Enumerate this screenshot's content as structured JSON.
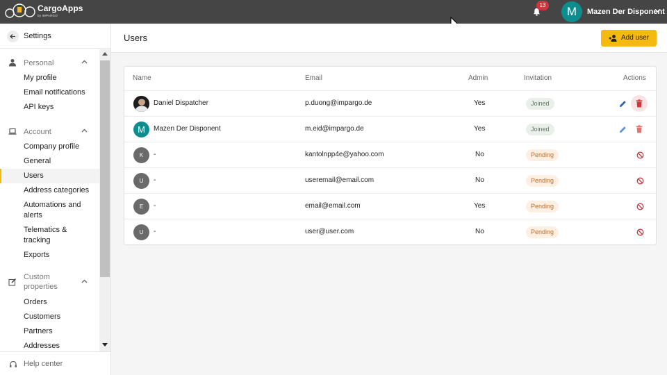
{
  "app": {
    "brand": "CargoApps",
    "brand_sub": "by IMPARGO",
    "notifications_count": "13",
    "user_initial": "M",
    "user_name": "Mazen Der Disponent"
  },
  "sidebar": {
    "title": "Settings",
    "sections": [
      {
        "label": "Personal",
        "items": [
          "My profile",
          "Email notifications",
          "API keys"
        ]
      },
      {
        "label": "Account",
        "items": [
          "Company profile",
          "General",
          "Users",
          "Address categories",
          "Automations and alerts",
          "Telematics & tracking",
          "Exports"
        ]
      },
      {
        "label": "Custom properties",
        "items": [
          "Orders",
          "Customers",
          "Partners",
          "Addresses"
        ]
      }
    ],
    "active_item": "Users",
    "footer": "Help center"
  },
  "page": {
    "title": "Users",
    "add_button": "Add user"
  },
  "table": {
    "columns": [
      "Name",
      "Email",
      "Admin",
      "Invitation",
      "Actions"
    ],
    "rows": [
      {
        "initial": "",
        "name": "Daniel Dispatcher",
        "email": "p.duong@impargo.de",
        "admin": "Yes",
        "invitation": "Joined"
      },
      {
        "initial": "M",
        "name": "Mazen Der Disponent",
        "email": "m.eid@impargo.de",
        "admin": "Yes",
        "invitation": "Joined"
      },
      {
        "initial": "K",
        "name": "-",
        "email": "kantolnpp4e@yahoo.com",
        "admin": "No",
        "invitation": "Pending"
      },
      {
        "initial": "U",
        "name": "-",
        "email": "useremail@email.com",
        "admin": "No",
        "invitation": "Pending"
      },
      {
        "initial": "E",
        "name": "-",
        "email": "email@email.com",
        "admin": "Yes",
        "invitation": "Pending"
      },
      {
        "initial": "U",
        "name": "-",
        "email": "user@user.com",
        "admin": "No",
        "invitation": "Pending"
      }
    ]
  },
  "colors": {
    "accent": "#f5b90f",
    "topbar": "#454545",
    "teal": "#0d8d8d",
    "gray_avatar": "#6a6a6a",
    "danger": "#d1343c",
    "edit": "#3a74c9"
  },
  "icons": {
    "back": "arrow-left-icon",
    "personal": "person-icon",
    "account": "laptop-icon",
    "custom": "edit-square-icon",
    "help": "headset-icon",
    "bell": "bell-icon",
    "edit": "pencil-icon",
    "delete": "trash-icon",
    "revoke": "ban-icon"
  }
}
